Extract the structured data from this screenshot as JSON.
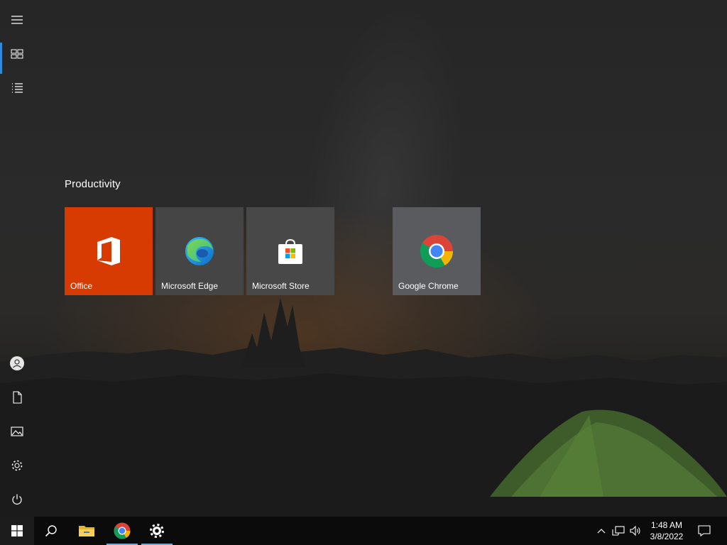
{
  "start_menu": {
    "rail_top": [
      {
        "name": "hamburger-menu-icon",
        "label": "Expand"
      },
      {
        "name": "all-tiles-icon",
        "label": "Pinned tiles"
      },
      {
        "name": "all-apps-list-icon",
        "label": "All apps"
      }
    ],
    "rail_bottom": [
      {
        "name": "user-account-icon",
        "label": "Account"
      },
      {
        "name": "documents-icon",
        "label": "Documents"
      },
      {
        "name": "pictures-icon",
        "label": "Pictures"
      },
      {
        "name": "settings-gear-icon",
        "label": "Settings"
      },
      {
        "name": "power-icon",
        "label": "Power"
      }
    ],
    "group_title": "Productivity",
    "tiles": [
      {
        "label": "Office",
        "color": "#d83b01"
      },
      {
        "label": "Microsoft Edge",
        "color": "#454545"
      },
      {
        "label": "Microsoft Store",
        "color": "#484848"
      },
      {
        "label": "Google Chrome",
        "color": "#5a5b5e"
      }
    ]
  },
  "taskbar": {
    "items": [
      {
        "name": "start-button",
        "icon": "windows-logo-icon"
      },
      {
        "name": "search-button",
        "icon": "search-icon"
      },
      {
        "name": "file-explorer-button",
        "icon": "folder-icon",
        "running": false
      },
      {
        "name": "chrome-taskbar-button",
        "icon": "chrome-icon",
        "running": true
      },
      {
        "name": "settings-taskbar-button",
        "icon": "gear-icon",
        "running": true
      }
    ],
    "tray": {
      "icons": [
        "chevron-up-icon",
        "network-icon",
        "volume-icon"
      ],
      "time": "1:48 AM",
      "date": "3/8/2022",
      "notification_icon": "action-center-icon"
    }
  },
  "colors": {
    "accent": "#2f8bd9",
    "taskbar": "#0b0b0b",
    "office_tile": "#d83b01"
  }
}
